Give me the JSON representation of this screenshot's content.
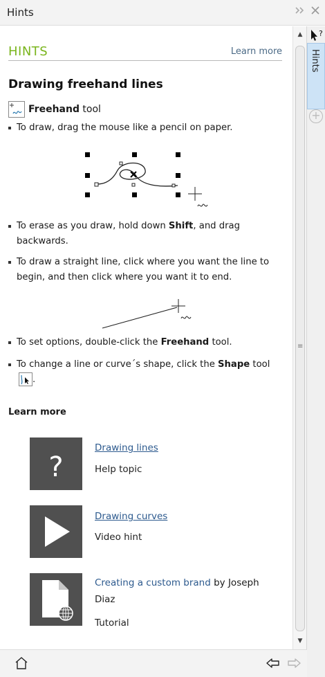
{
  "window": {
    "title": "Hints"
  },
  "header": {
    "label": "HINTS",
    "learn_more": "Learn more"
  },
  "topic": {
    "title": "Drawing freehand lines",
    "tool_name": "Freehand",
    "tool_suffix": " tool"
  },
  "bullets": {
    "b1": "To draw, drag the mouse like a pencil on paper.",
    "b2_pre": "To erase as you draw, hold down ",
    "b2_key": "Shift",
    "b2_post": ", and drag backwards.",
    "b3": "To draw a straight line, click where you want the line to begin, and then click where you want it to end.",
    "b4_pre": "To set options, double-click the ",
    "b4_key": "Freehand",
    "b4_post": " tool.",
    "b5_pre": "To change a line or curve´s shape, click the ",
    "b5_key": "Shape",
    "b5_post": " tool",
    "b5_end": "."
  },
  "learn_section": {
    "title": "Learn more"
  },
  "cards": [
    {
      "link": "Drawing lines",
      "type": "Help topic",
      "icon": "question-icon"
    },
    {
      "link": "Drawing curves",
      "type": "Video hint",
      "icon": "play-icon"
    },
    {
      "link": "Creating a custom brand",
      "by": " by Joseph",
      "author": "Diaz",
      "type": "Tutorial",
      "icon": "document-globe-icon"
    }
  ],
  "side_tab": {
    "label": "Hints"
  },
  "colors": {
    "accent": "#7ab51d",
    "link": "#2d5a8e",
    "tile": "#505050",
    "tab": "#cde3f6"
  }
}
